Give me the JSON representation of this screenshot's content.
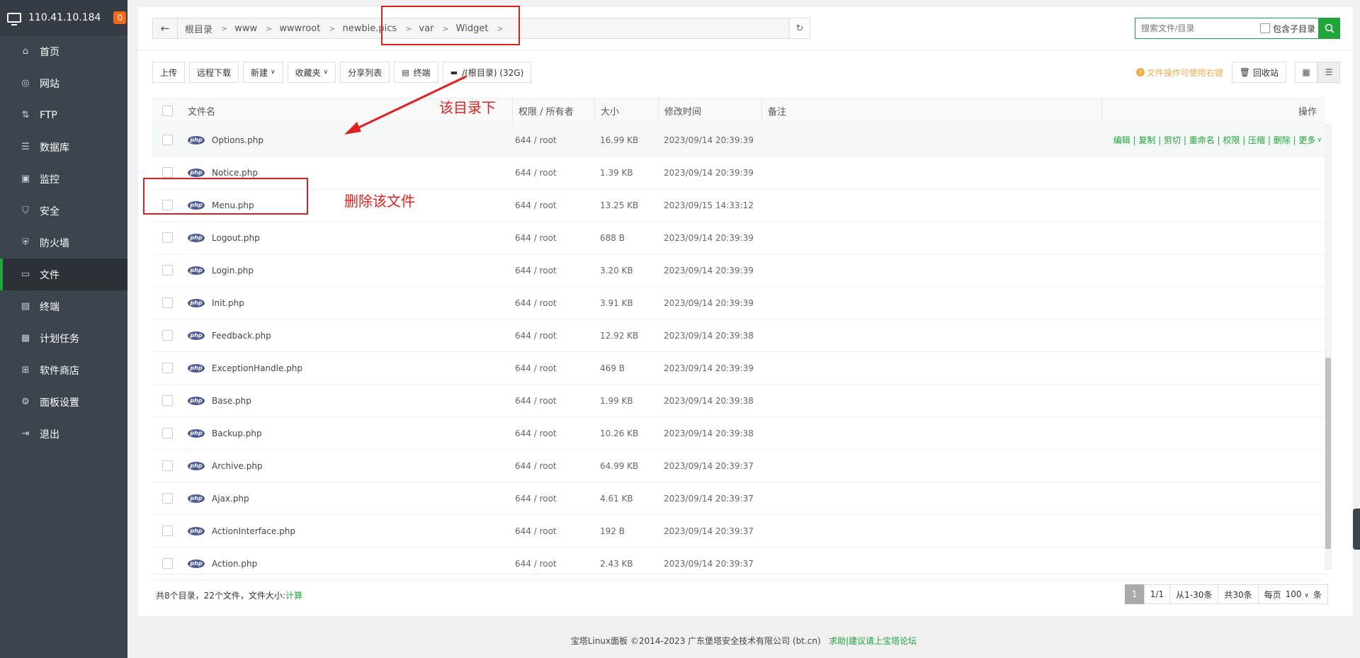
{
  "server": {
    "ip": "110.41.10.184",
    "badge": "0"
  },
  "sidebar": {
    "items": [
      {
        "label": "首页",
        "icon": "home-icon",
        "glyph": "⌂"
      },
      {
        "label": "网站",
        "icon": "globe-icon",
        "glyph": "◎"
      },
      {
        "label": "FTP",
        "icon": "ftp-icon",
        "glyph": "⇅"
      },
      {
        "label": "数据库",
        "icon": "database-icon",
        "glyph": "☰"
      },
      {
        "label": "监控",
        "icon": "monitor-icon",
        "glyph": "▣"
      },
      {
        "label": "安全",
        "icon": "shield-icon",
        "glyph": "⛉"
      },
      {
        "label": "防火墙",
        "icon": "firewall-icon",
        "glyph": "⛨"
      },
      {
        "label": "文件",
        "icon": "folder-icon",
        "glyph": "▭"
      },
      {
        "label": "终端",
        "icon": "terminal-icon",
        "glyph": "▤"
      },
      {
        "label": "计划任务",
        "icon": "calendar-icon",
        "glyph": "▦"
      },
      {
        "label": "软件商店",
        "icon": "apps-icon",
        "glyph": "⊞"
      },
      {
        "label": "面板设置",
        "icon": "gear-icon",
        "glyph": "⚙"
      },
      {
        "label": "退出",
        "icon": "logout-icon",
        "glyph": "⇥"
      }
    ]
  },
  "breadcrumb": {
    "items": [
      "根目录",
      "www",
      "wwwroot",
      "newbie.pics",
      "var",
      "Widget"
    ]
  },
  "search": {
    "placeholder": "搜索文件/目录",
    "include_sub": "包含子目录"
  },
  "toolbar": {
    "upload": "上传",
    "remote_download": "远程下载",
    "new": "新建",
    "favorites": "收藏夹",
    "share_list": "分享列表",
    "terminal": "终端",
    "disk": "/(根目录) (32G)",
    "tip": "文件操作可使用右键",
    "recycle": "回收站"
  },
  "table": {
    "headers": {
      "name": "文件名",
      "perm": "权限 / 所有者",
      "size": "大小",
      "mtime": "修改时间",
      "note": "备注",
      "ops": "操作"
    },
    "row_ops": "编辑 | 复制 | 剪切 | 重命名 | 权限 | 压缩 | 删除 | 更多",
    "php_label": "php",
    "rows": [
      {
        "name": "Options.php",
        "perm": "644 / root",
        "size": "16.99 KB",
        "mtime": "2023/09/14 20:39:39"
      },
      {
        "name": "Notice.php",
        "perm": "644 / root",
        "size": "1.39 KB",
        "mtime": "2023/09/14 20:39:39"
      },
      {
        "name": "Menu.php",
        "perm": "644 / root",
        "size": "13.25 KB",
        "mtime": "2023/09/15 14:33:12"
      },
      {
        "name": "Logout.php",
        "perm": "644 / root",
        "size": "688 B",
        "mtime": "2023/09/14 20:39:39"
      },
      {
        "name": "Login.php",
        "perm": "644 / root",
        "size": "3.20 KB",
        "mtime": "2023/09/14 20:39:39"
      },
      {
        "name": "Init.php",
        "perm": "644 / root",
        "size": "3.91 KB",
        "mtime": "2023/09/14 20:39:39"
      },
      {
        "name": "Feedback.php",
        "perm": "644 / root",
        "size": "12.92 KB",
        "mtime": "2023/09/14 20:39:38"
      },
      {
        "name": "ExceptionHandle.php",
        "perm": "644 / root",
        "size": "469 B",
        "mtime": "2023/09/14 20:39:39"
      },
      {
        "name": "Base.php",
        "perm": "644 / root",
        "size": "1.99 KB",
        "mtime": "2023/09/14 20:39:38"
      },
      {
        "name": "Backup.php",
        "perm": "644 / root",
        "size": "10.26 KB",
        "mtime": "2023/09/14 20:39:38"
      },
      {
        "name": "Archive.php",
        "perm": "644 / root",
        "size": "64.99 KB",
        "mtime": "2023/09/14 20:39:37"
      },
      {
        "name": "Ajax.php",
        "perm": "644 / root",
        "size": "4.61 KB",
        "mtime": "2023/09/14 20:39:37"
      },
      {
        "name": "ActionInterface.php",
        "perm": "644 / root",
        "size": "192 B",
        "mtime": "2023/09/14 20:39:37"
      },
      {
        "name": "Action.php",
        "perm": "644 / root",
        "size": "2.43 KB",
        "mtime": "2023/09/14 20:39:37"
      }
    ]
  },
  "summary": {
    "text": "共8个目录，22个文件，文件大小:",
    "calc": "计算"
  },
  "pager": {
    "current": "1",
    "pages": "1/1",
    "range": "从1-30条",
    "total": "共30条",
    "per_page_label": "每页",
    "per_page": "100",
    "unit": "条"
  },
  "footer": {
    "copyright": "宝塔Linux面板 ©2014-2023 广东堡塔安全技术有限公司 (bt.cn)",
    "link": "求助|建议请上宝塔论坛"
  },
  "annotations": {
    "dir_note": "该目录下",
    "delete_note": "删除该文件"
  },
  "colors": {
    "accent": "#20a53a",
    "sidebar": "#3c444d",
    "annotation": "#e02020"
  }
}
